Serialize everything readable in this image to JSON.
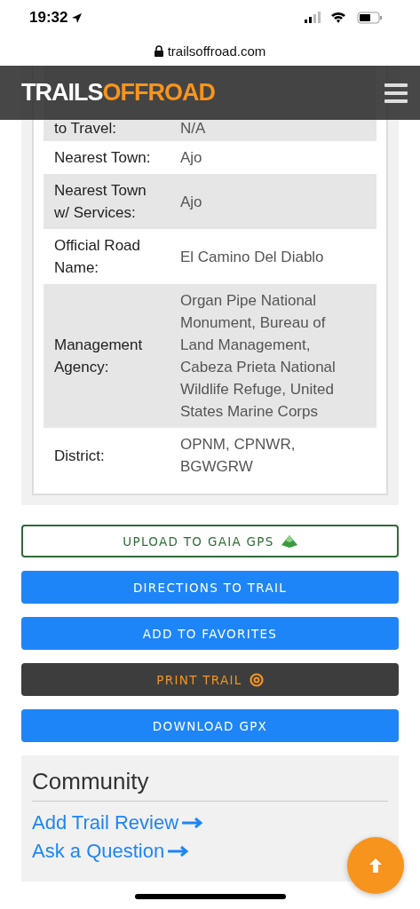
{
  "status_bar": {
    "time": "19:32"
  },
  "url_bar": {
    "address": "trailsoffroad.com"
  },
  "header": {
    "logo_part_1": "TRAILS",
    "logo_part_2": "OFFROAD"
  },
  "details": [
    {
      "label": "to Travel:",
      "value": "N/A"
    },
    {
      "label": "Nearest Town:",
      "value": "Ajo"
    },
    {
      "label": "Nearest Town w/ Services:",
      "value": "Ajo"
    },
    {
      "label": "Official Road Name:",
      "value": "El Camino Del Diablo"
    },
    {
      "label": "Management Agency:",
      "value": "Organ Pipe National Monument, Bureau of Land Management, Cabeza Prieta National Wildlife Refuge, United States Marine Corps"
    },
    {
      "label": "District:",
      "value": "OPNM, CPNWR, BGWGRW"
    }
  ],
  "buttons": [
    {
      "label": "UPLOAD TO GAIA GPS",
      "kind": "outline"
    },
    {
      "label": "DIRECTIONS TO TRAIL",
      "kind": "primary"
    },
    {
      "label": "ADD TO FAVORITES",
      "kind": "primary"
    },
    {
      "label": "PRINT TRAIL",
      "kind": "dark"
    },
    {
      "label": "DOWNLOAD GPX",
      "kind": "primary"
    }
  ],
  "community": {
    "title": "Community",
    "links": [
      "Add Trail Review",
      "Ask a Question"
    ]
  }
}
